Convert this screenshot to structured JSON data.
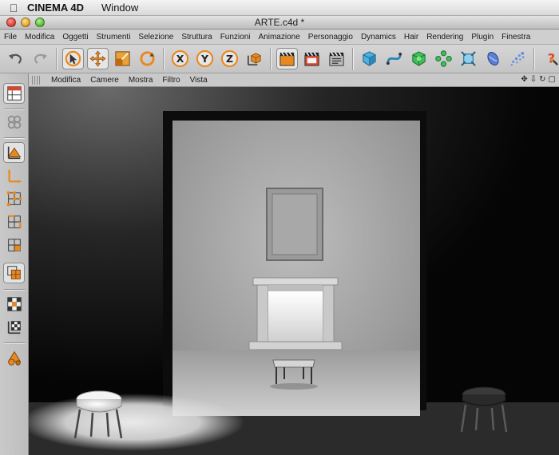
{
  "menubar": {
    "app_name": "CINEMA 4D",
    "items": [
      "Window"
    ]
  },
  "window": {
    "title": "ARTE.c4d *"
  },
  "app_menu": {
    "items": [
      "File",
      "Modifica",
      "Oggetti",
      "Strumenti",
      "Selezione",
      "Struttura",
      "Funzioni",
      "Animazione",
      "Personaggio",
      "Dynamics",
      "Hair",
      "Rendering",
      "Plugin",
      "Finestra"
    ]
  },
  "toolbar": {
    "axis_labels": [
      "X",
      "Y",
      "Z"
    ],
    "tools": [
      "undo-icon",
      "redo-icon",
      "live-select-icon",
      "move-icon",
      "scale-icon",
      "rotate-icon",
      "x-axis-lock-icon",
      "y-axis-lock-icon",
      "z-axis-lock-icon",
      "coordinate-system-icon",
      "render-view-icon",
      "render-picture-viewer-icon",
      "render-settings-icon",
      "cube-primitive-icon",
      "spline-icon",
      "nurbs-icon",
      "array-icon",
      "deformer-icon",
      "environment-icon",
      "particle-icon",
      "help-icon",
      "layout-icon"
    ]
  },
  "viewport": {
    "menu": [
      "Modifica",
      "Camere",
      "Mostra",
      "Filtro",
      "Vista"
    ],
    "nav_icons": [
      "✥",
      "⇩",
      "↻",
      "▢"
    ]
  },
  "left_palette": {
    "tools": [
      "layout-panel-icon",
      "make-editable-icon",
      "model-mode-icon",
      "object-axis-icon",
      "points-mode-icon",
      "edges-mode-icon",
      "polygons-mode-icon",
      "texture-mode-icon",
      "uv-points-mode-icon",
      "workplane-icon",
      "snap-icon"
    ]
  },
  "colors": {
    "accent_orange": "#e8891f",
    "chrome_gray": "#c9c9c9",
    "viewport_bg": "#0a0a0a"
  }
}
